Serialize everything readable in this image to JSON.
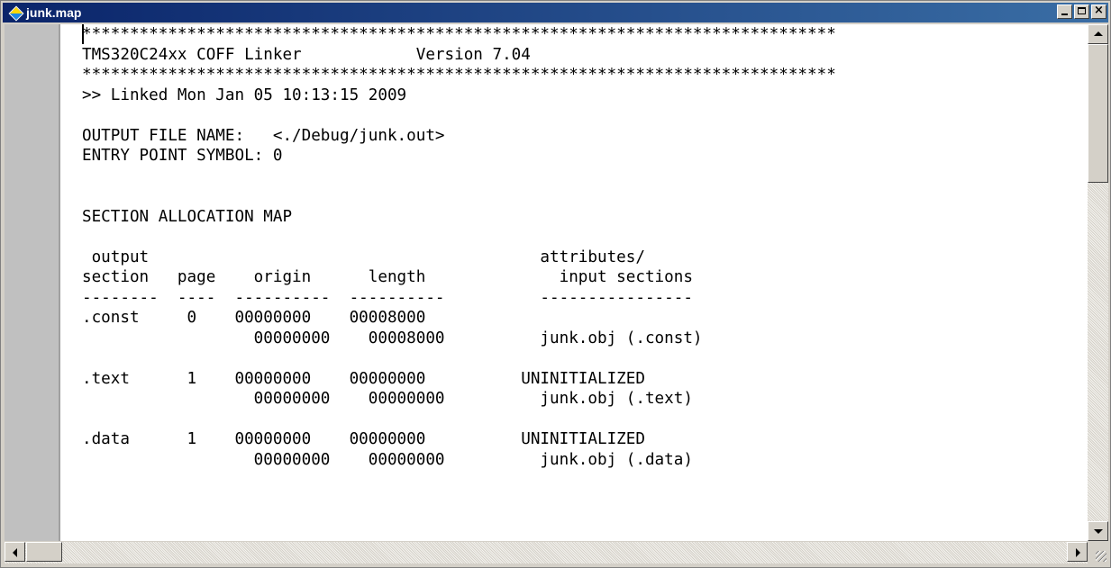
{
  "window": {
    "title": "junk.map",
    "icon": "app-diamond-icon"
  },
  "editor": {
    "lines": [
      "*******************************************************************************",
      "TMS320C24xx COFF Linker            Version 7.04",
      "*******************************************************************************",
      ">> Linked Mon Jan 05 10:13:15 2009",
      "",
      "OUTPUT FILE NAME:   <./Debug/junk.out>",
      "ENTRY POINT SYMBOL: 0",
      "",
      "",
      "SECTION ALLOCATION MAP",
      "",
      " output                                         attributes/",
      "section   page    origin      length              input sections",
      "--------  ----  ----------  ----------          ----------------",
      ".const     0    00000000    00008000",
      "                  00000000    00008000          junk.obj (.const)",
      "",
      ".text      1    00000000    00000000          UNINITIALIZED",
      "                  00000000    00000000          junk.obj (.text)",
      "",
      ".data      1    00000000    00000000          UNINITIALIZED",
      "                  00000000    00000000          junk.obj (.data)"
    ]
  }
}
